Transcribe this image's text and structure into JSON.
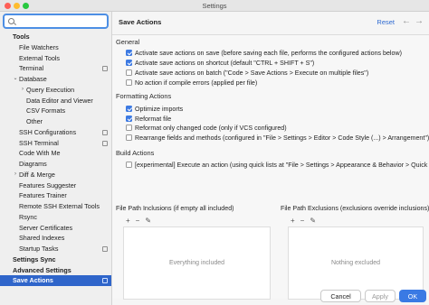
{
  "window": {
    "title": "Settings"
  },
  "sidebar": {
    "items": [
      {
        "label": "Tools",
        "indent": 0,
        "bold": true,
        "arrow": ""
      },
      {
        "label": "File Watchers",
        "indent": 1,
        "bold": false,
        "arrow": ""
      },
      {
        "label": "External Tools",
        "indent": 1,
        "bold": false,
        "arrow": ""
      },
      {
        "label": "Terminal",
        "indent": 1,
        "bold": false,
        "arrow": "",
        "page_icon": true
      },
      {
        "label": "Database",
        "indent": 1,
        "bold": false,
        "arrow": "⌄"
      },
      {
        "label": "Query Execution",
        "indent": 2,
        "bold": false,
        "arrow": "›"
      },
      {
        "label": "Data Editor and Viewer",
        "indent": 2,
        "bold": false,
        "arrow": ""
      },
      {
        "label": "CSV Formats",
        "indent": 2,
        "bold": false,
        "arrow": ""
      },
      {
        "label": "Other",
        "indent": 2,
        "bold": false,
        "arrow": ""
      },
      {
        "label": "SSH Configurations",
        "indent": 1,
        "bold": false,
        "arrow": "",
        "page_icon": true
      },
      {
        "label": "SSH Terminal",
        "indent": 1,
        "bold": false,
        "arrow": "",
        "page_icon": true
      },
      {
        "label": "Code With Me",
        "indent": 1,
        "bold": false,
        "arrow": ""
      },
      {
        "label": "Diagrams",
        "indent": 1,
        "bold": false,
        "arrow": ""
      },
      {
        "label": "Diff & Merge",
        "indent": 1,
        "bold": false,
        "arrow": "›"
      },
      {
        "label": "Features Suggester",
        "indent": 1,
        "bold": false,
        "arrow": ""
      },
      {
        "label": "Features Trainer",
        "indent": 1,
        "bold": false,
        "arrow": ""
      },
      {
        "label": "Remote SSH External Tools",
        "indent": 1,
        "bold": false,
        "arrow": ""
      },
      {
        "label": "Rsync",
        "indent": 1,
        "bold": false,
        "arrow": ""
      },
      {
        "label": "Server Certificates",
        "indent": 1,
        "bold": false,
        "arrow": ""
      },
      {
        "label": "Shared Indexes",
        "indent": 1,
        "bold": false,
        "arrow": ""
      },
      {
        "label": "Startup Tasks",
        "indent": 1,
        "bold": false,
        "arrow": "",
        "page_icon": true
      },
      {
        "label": "Settings Sync",
        "indent": 0,
        "bold": true,
        "arrow": ""
      },
      {
        "label": "Advanced Settings",
        "indent": 0,
        "bold": true,
        "arrow": ""
      },
      {
        "label": "Save Actions",
        "indent": 0,
        "bold": true,
        "arrow": "",
        "selected": true,
        "page_icon": true
      }
    ]
  },
  "header": {
    "title": "Save Actions",
    "reset_label": "Reset",
    "back_icon": "←",
    "forward_icon": "→"
  },
  "general": {
    "title": "General",
    "options": [
      {
        "label": "Activate save actions on save (before saving each file, performs the configured actions below)",
        "checked": true
      },
      {
        "label": "Activate save actions on shortcut (default \"CTRL + SHIFT + S\")",
        "checked": true
      },
      {
        "label": "Activate save actions on batch (\"Code > Save Actions > Execute on multiple files\")",
        "checked": false
      },
      {
        "label": "No action if compile errors (applied per file)",
        "checked": false
      }
    ]
  },
  "formatting": {
    "title": "Formatting Actions",
    "options": [
      {
        "label": "Optimize imports",
        "checked": true
      },
      {
        "label": "Reformat file",
        "checked": true
      },
      {
        "label": "Reformat only changed code (only if VCS configured)",
        "checked": false
      },
      {
        "label": "Rearrange fields and methods (configured in \"File > Settings > Editor > Code Style (...) > Arrangement\")",
        "checked": false
      }
    ]
  },
  "build": {
    "title": "Build Actions",
    "options": [
      {
        "label": "[experimental] Execute an action (using quick lists at \"File > Settings > Appearance & Behavior > Quick Lists\")",
        "checked": false
      }
    ]
  },
  "inclusions": {
    "title": "File Path Inclusions (if empty all included)",
    "empty_text": "Everything included"
  },
  "exclusions": {
    "title": "File Path Exclusions (exclusions override inclusions)",
    "empty_text": "Nothing excluded"
  },
  "toolbar": {
    "add": "+",
    "remove": "−",
    "edit": "✎"
  },
  "buttons": {
    "cancel": "Cancel",
    "apply": "Apply",
    "ok": "OK"
  },
  "colors": {
    "accent": "#2f65ca",
    "link": "#2e6ad1",
    "ok_button": "#3a7ae4"
  }
}
